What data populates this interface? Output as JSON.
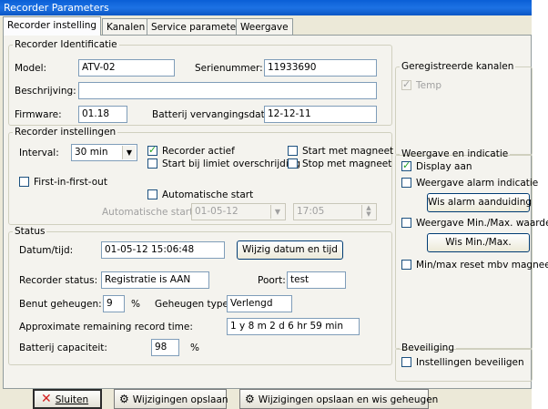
{
  "window": {
    "title": "Recorder Parameters"
  },
  "tabs": [
    {
      "label": "Recorder instelling",
      "active": true
    },
    {
      "label": "Kanalen"
    },
    {
      "label": "Service parameters"
    },
    {
      "label": "Weergave"
    }
  ],
  "identificatie": {
    "legend": "Recorder Identificatie",
    "model_label": "Model:",
    "model_value": "ATV-02",
    "serie_label": "Serienummer:",
    "serie_value": "11933690",
    "beschrijving_label": "Beschrijving:",
    "beschrijving_value": "",
    "firmware_label": "Firmware:",
    "firmware_value": "01.18",
    "batterij_label": "Batterij vervangingsdatum:",
    "batterij_value": "12-12-11"
  },
  "instellingen": {
    "legend": "Recorder instellingen",
    "interval_label": "Interval:",
    "interval_value": "30 min",
    "recorder_actief": "Recorder actief",
    "start_limiet": "Start bij limiet overschrijding",
    "start_magneet": "Start met magneet",
    "stop_magneet": "Stop met magneet",
    "fifo": "First-in-first-out",
    "auto_start": "Automatische start",
    "auto_start_label": "Automatische start:",
    "auto_date": "01-05-12",
    "auto_time": "17:05"
  },
  "status": {
    "legend": "Status",
    "datum_label": "Datum/tijd:",
    "datum_value": "01-05-12 15:06:48",
    "wijzig_btn": "Wijzig datum en tijd",
    "rec_status_label": "Recorder status:",
    "rec_status_value": "Registratie is AAN",
    "poort_label": "Poort:",
    "poort_value": "test",
    "benut_label": "Benut geheugen:",
    "benut_value": "9",
    "benut_unit": "%",
    "geheugen_type_label": "Geheugen type:",
    "geheugen_type_value": "Verlengd",
    "remaining_label": "Approximate remaining record time:",
    "remaining_value": "1 y 8 m 2 d 6 hr 59 min",
    "batterij_cap_label": "Batterij capaciteit:",
    "batterij_cap_value": "98",
    "batterij_cap_unit": "%"
  },
  "kanalen": {
    "legend": "Geregistreerde kanalen",
    "temp": "Temp"
  },
  "weergave": {
    "legend": "Weergave en indicatie",
    "display_aan": "Display aan",
    "alarm_indicatie": "Weergave alarm indicatie",
    "wis_alarm_btn": "Wis alarm aanduiding",
    "minmax_waarden": "Weergave Min./Max. waarden",
    "wis_minmax_btn": "Wis Min./Max.",
    "minmax_reset": "Min/max reset mbv magneet"
  },
  "beveiliging": {
    "legend": "Beveiliging",
    "instellingen": "Instellingen beveiligen"
  },
  "buttons": {
    "sluiten": "Sluiten",
    "opslaan": "Wijzigingen opslaan",
    "opslaan_wis": "Wijzigingen opslaan en wis geheugen"
  },
  "colors": {
    "titlebar": "#0a5fd6",
    "window_bg": "#ece9d8",
    "panel_bg": "#f4f3ee",
    "check_green": "#21a121",
    "close_red": "#d42020"
  }
}
